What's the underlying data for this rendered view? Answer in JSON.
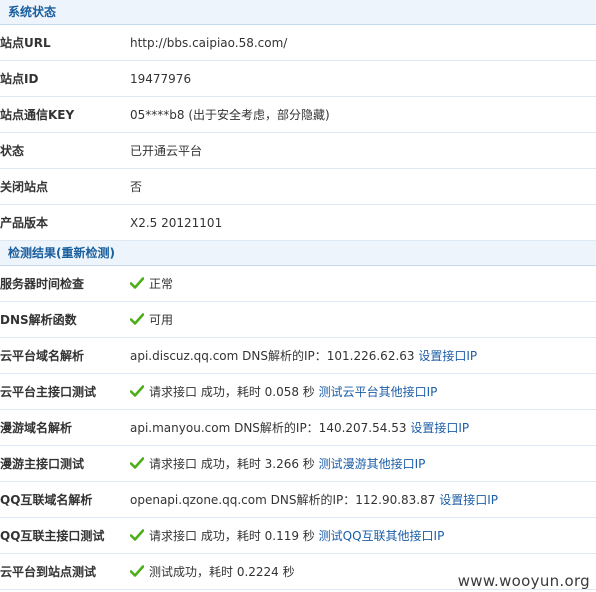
{
  "sections": {
    "system_status": {
      "title": "系统状态"
    },
    "check_results": {
      "title": "检测结果",
      "recheck_link": "(重新检测)"
    }
  },
  "status_rows": [
    {
      "label": "站点URL",
      "value": "http://bbs.caipiao.58.com/"
    },
    {
      "label": "站点ID",
      "value": "19477976"
    },
    {
      "label": "站点通信KEY",
      "value": "05****b8 (出于安全考虑，部分隐藏)"
    },
    {
      "label": "状态",
      "value": "已开通云平台"
    },
    {
      "label": "关闭站点",
      "value": "否"
    },
    {
      "label": "产品版本",
      "value": "X2.5 20121101"
    }
  ],
  "check_rows": [
    {
      "label": "服务器时间检查",
      "ok": true,
      "value": "正常",
      "link": ""
    },
    {
      "label": "DNS解析函数",
      "ok": true,
      "value": "可用",
      "link": ""
    },
    {
      "label": "云平台域名解析",
      "ok": false,
      "value": "api.discuz.qq.com DNS解析的IP：101.226.62.63",
      "link": "设置接口IP"
    },
    {
      "label": "云平台主接口测试",
      "ok": true,
      "value": "请求接口 成功，耗时 0.058 秒",
      "link": "测试云平台其他接口IP"
    },
    {
      "label": "漫游域名解析",
      "ok": false,
      "value": "api.manyou.com DNS解析的IP：140.207.54.53",
      "link": "设置接口IP"
    },
    {
      "label": "漫游主接口测试",
      "ok": true,
      "value": "请求接口 成功，耗时 3.266 秒",
      "link": "测试漫游其他接口IP"
    },
    {
      "label": "QQ互联域名解析",
      "ok": false,
      "value": "openapi.qzone.qq.com DNS解析的IP：112.90.83.87",
      "link": "设置接口IP"
    },
    {
      "label": "QQ互联主接口测试",
      "ok": true,
      "value": "请求接口 成功，耗时 0.119 秒",
      "link": "测试QQ互联其他接口IP"
    },
    {
      "label": "云平台到站点测试",
      "ok": true,
      "value": "测试成功，耗时 0.2224 秒",
      "link": ""
    }
  ],
  "watermark": "www.wooyun.org",
  "colors": {
    "header_bg": "#eef4fb",
    "accent": "#1a5f9e",
    "link": "#1c5ea8",
    "check": "#4caf1a"
  },
  "icons": {
    "ok": "check-icon"
  }
}
